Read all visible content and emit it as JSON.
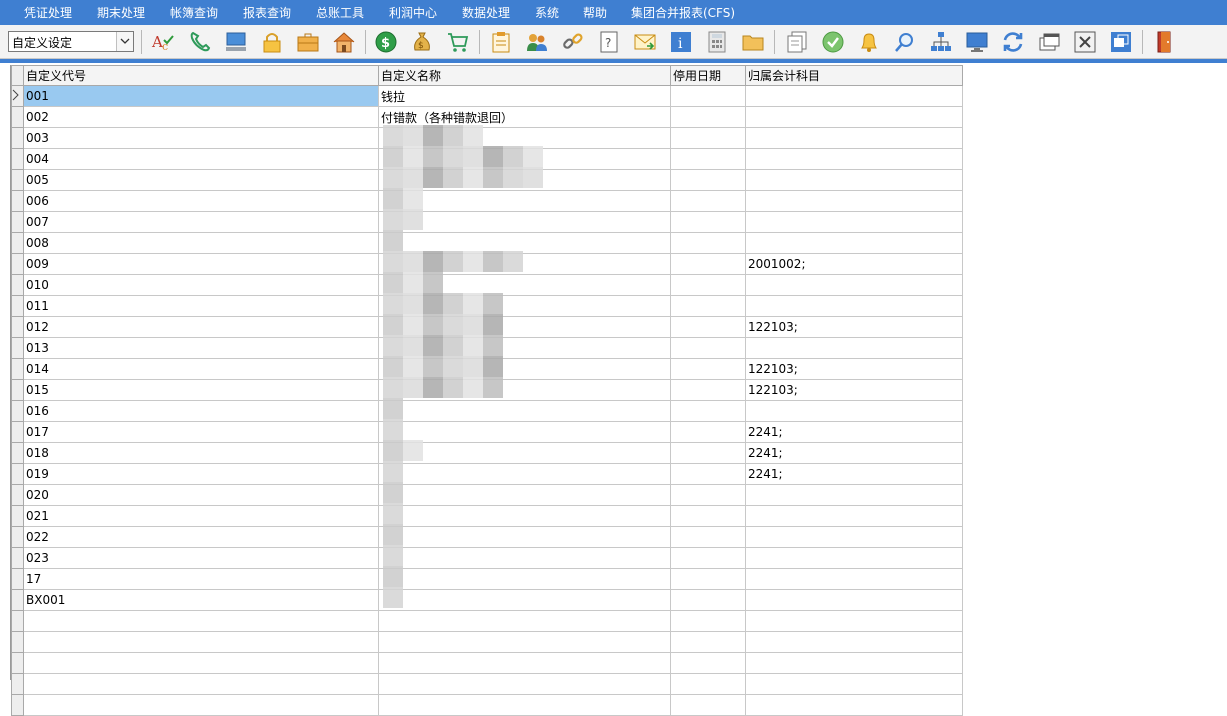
{
  "menu": [
    "凭证处理",
    "期末处理",
    "帐簿查询",
    "报表查询",
    "总账工具",
    "利润中心",
    "数据处理",
    "系统",
    "帮助",
    "集团合并报表(CFS)"
  ],
  "toolbar": {
    "combo_value": "自定义设定"
  },
  "grid": {
    "columns": [
      "自定义代号",
      "自定义名称",
      "停用日期",
      "归属会计科目"
    ],
    "rows": [
      {
        "code": "001",
        "name": "钱拉",
        "date": "",
        "account": ""
      },
      {
        "code": "002",
        "name": "付错款（各种错款退回）",
        "date": "",
        "account": ""
      },
      {
        "code": "003",
        "name": "",
        "date": "",
        "account": ""
      },
      {
        "code": "004",
        "name": "",
        "date": "",
        "account": ""
      },
      {
        "code": "005",
        "name": "",
        "date": "",
        "account": ""
      },
      {
        "code": "006",
        "name": "",
        "date": "",
        "account": ""
      },
      {
        "code": "007",
        "name": "",
        "date": "",
        "account": ""
      },
      {
        "code": "008",
        "name": "",
        "date": "",
        "account": ""
      },
      {
        "code": "009",
        "name": "",
        "date": "",
        "account": "2001002;"
      },
      {
        "code": "010",
        "name": "",
        "date": "",
        "account": ""
      },
      {
        "code": "011",
        "name": "",
        "date": "",
        "account": ""
      },
      {
        "code": "012",
        "name": "",
        "date": "",
        "account": "122103;"
      },
      {
        "code": "013",
        "name": "",
        "date": "",
        "account": ""
      },
      {
        "code": "014",
        "name": "",
        "date": "",
        "account": "122103;"
      },
      {
        "code": "015",
        "name": "",
        "date": "",
        "account": "122103;"
      },
      {
        "code": "016",
        "name": "",
        "date": "",
        "account": ""
      },
      {
        "code": "017",
        "name": "",
        "date": "",
        "account": "2241;"
      },
      {
        "code": "018",
        "name": "",
        "date": "",
        "account": "2241;"
      },
      {
        "code": "019",
        "name": "",
        "date": "",
        "account": "2241;"
      },
      {
        "code": "020",
        "name": "",
        "date": "",
        "account": ""
      },
      {
        "code": "021",
        "name": "",
        "date": "",
        "account": ""
      },
      {
        "code": "022",
        "name": "",
        "date": "",
        "account": ""
      },
      {
        "code": "023",
        "name": "",
        "date": "",
        "account": ""
      },
      {
        "code": "17",
        "name": "",
        "date": "",
        "account": ""
      },
      {
        "code": "BX001",
        "name": "",
        "date": "",
        "account": ""
      },
      {
        "code": "",
        "name": "",
        "date": "",
        "account": ""
      },
      {
        "code": "",
        "name": "",
        "date": "",
        "account": ""
      },
      {
        "code": "",
        "name": "",
        "date": "",
        "account": ""
      },
      {
        "code": "",
        "name": "",
        "date": "",
        "account": ""
      },
      {
        "code": "",
        "name": "",
        "date": "",
        "account": ""
      }
    ],
    "selected_row": 0
  },
  "icons": [
    "spellcheck-icon",
    "phone-icon",
    "computer-icon",
    "lock-icon",
    "briefcase-icon",
    "house-icon",
    "dollar-coin-icon",
    "money-bag-icon",
    "shopping-cart-icon",
    "clipboard-icon",
    "users-icon",
    "link-icon",
    "help-document-icon",
    "mail-icon",
    "info-icon",
    "calculator-icon",
    "folder-icon",
    "copy-document-icon",
    "checkmark-icon",
    "bell-icon",
    "search-icon",
    "org-chart-icon",
    "monitor-icon",
    "refresh-icon",
    "restore-window-icon",
    "close-icon",
    "window-icon",
    "exit-door-icon"
  ],
  "colors": {
    "menubar": "#3f7fd1",
    "selected_cell": "#99c9f0",
    "blur": "#cfcfcf"
  }
}
